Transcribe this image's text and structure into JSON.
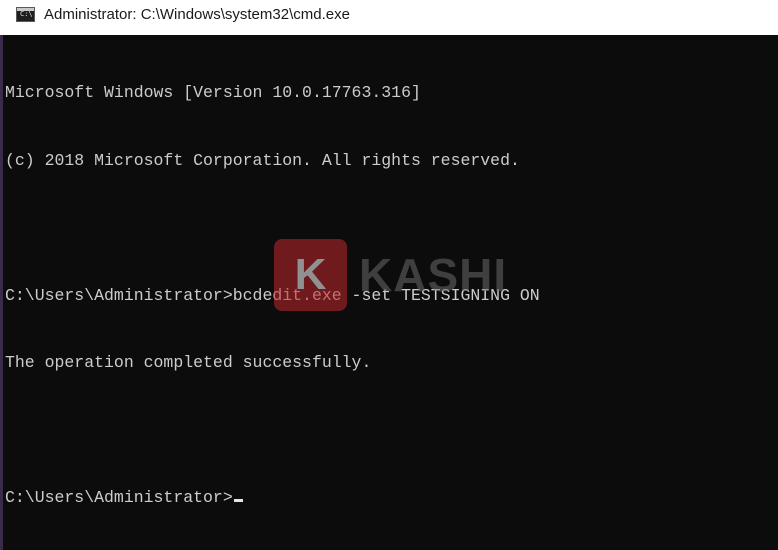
{
  "window": {
    "title": "Administrator: C:\\Windows\\system32\\cmd.exe",
    "icon": "cmd-icon",
    "icon_prompt": "C:\\"
  },
  "console": {
    "lines": [
      "Microsoft Windows [Version 10.0.17763.316]",
      "(c) 2018 Microsoft Corporation. All rights reserved.",
      "",
      "C:\\Users\\Administrator>bcdedit.exe -set TESTSIGNING ON",
      "The operation completed successfully.",
      "",
      "C:\\Users\\Administrator>"
    ],
    "text_color": "#cccccc",
    "background": "#0c0c0c"
  },
  "watermark": {
    "letter": "K",
    "word": "KASHI",
    "brand_color": "#c0282d"
  }
}
